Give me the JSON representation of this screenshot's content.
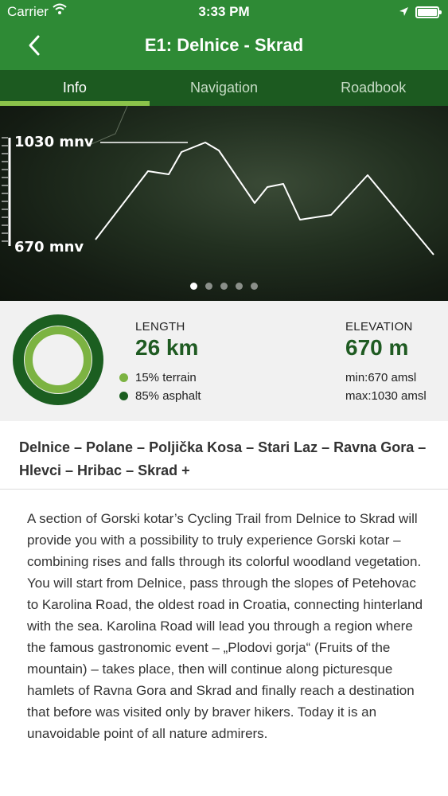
{
  "status_bar": {
    "carrier": "Carrier",
    "time": "3:33 PM"
  },
  "header": {
    "title": "E1: Delnice - Skrad",
    "back_icon": "chevron-left-icon"
  },
  "tabs": [
    {
      "label": "Info",
      "active": true
    },
    {
      "label": "Navigation",
      "active": false
    },
    {
      "label": "Roadbook",
      "active": false
    }
  ],
  "profile": {
    "max_label": "1030 mnv",
    "min_label": "670 mnv",
    "pages": 5,
    "current_page": 1
  },
  "stats": {
    "length_label": "LENGTH",
    "length_value": "26 km",
    "terrain": "15% terrain",
    "asphalt": "85% asphalt",
    "terrain_fraction": 0.15,
    "asphalt_fraction": 0.85,
    "elevation_label": "ELEVATION",
    "elevation_value": "670 m",
    "min": "min:670 amsl",
    "max": "max:1030 amsl"
  },
  "colors": {
    "header_green": "#2e8a35",
    "tab_bar_green": "#1c5a20",
    "accent_light_green": "#8bc34a",
    "dark_green": "#1f5b22",
    "terrain_green": "#7cb342",
    "asphalt_green": "#1b5e20"
  },
  "route": "Delnice – Polane – Poljička Kosa – Stari Laz – Ravna Gora – Hlevci – Hribac – Skrad +",
  "description": "A section of Gorski kotar’s Cycling Trail from Delnice to Skrad will provide you with a possibility to truly experience Gorski kotar – combining rises and falls through its colorful woodland vegetation. You will start from Delnice, pass through the slopes of Petehovac to Karolina Road, the oldest road in Croatia, connecting hinterland with the sea. Karolina Road will lead you through a region where the famous gastronomic event – „Plodovi gorja“ (Fruits of the mountain) – takes place, then will continue along picturesque hamlets of Ravna Gora and Skrad and finally reach a destination that before was visited only by braver hikers. Today it is an unavoidable point of all nature admirers."
}
